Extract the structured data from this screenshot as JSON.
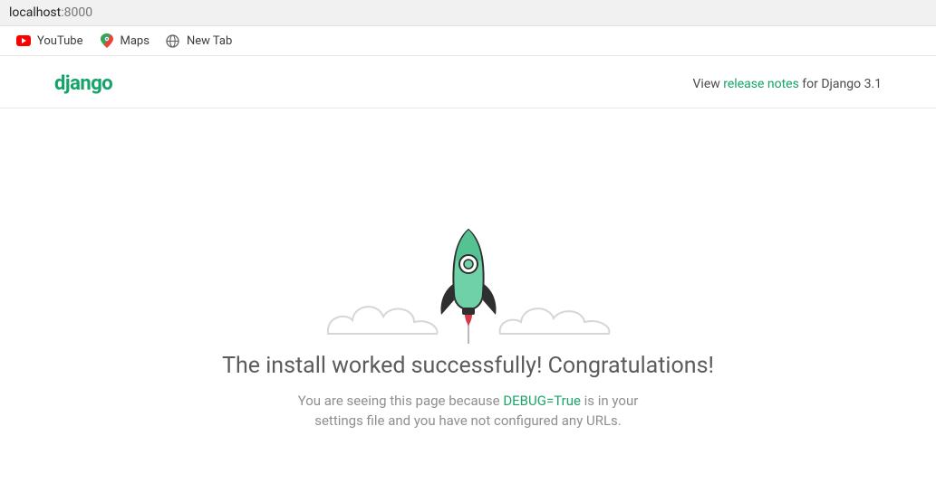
{
  "browser": {
    "url_host": "localhost",
    "url_port": ":8000",
    "bookmarks": [
      {
        "id": "youtube",
        "label": "YouTube"
      },
      {
        "id": "maps",
        "label": "Maps"
      },
      {
        "id": "newtab",
        "label": "New Tab"
      }
    ]
  },
  "header": {
    "logo": "django",
    "release_prefix": "View ",
    "release_link": "release notes",
    "release_suffix": " for Django 3.1"
  },
  "main": {
    "headline": "The install worked successfully! Congratulations!",
    "sub_part1": "You are seeing this page because ",
    "debug_text": "DEBUG=True",
    "sub_part2": " is in your settings file and you have not configured any URLs."
  }
}
